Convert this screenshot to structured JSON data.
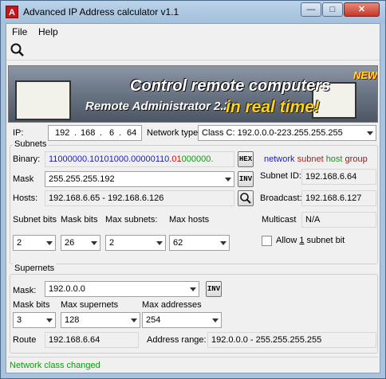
{
  "window": {
    "title": "Advanced IP Address calculator v1.1"
  },
  "window_controls": {
    "minimize": "—",
    "maximize": "□",
    "close": "✕"
  },
  "menu": {
    "file": "File",
    "help": "Help"
  },
  "banner": {
    "line1": "Control remote computers",
    "line2": "Remote Administrator 2.2",
    "line3": "in real time!",
    "badge": "NEW!"
  },
  "ip": {
    "label": "IP:",
    "octet1": "192",
    "octet2": "168",
    "octet3": "6",
    "octet4": "64",
    "network_type_label": "Network type:",
    "network_type_value": "Class C: 192.0.0.0-223.255.255.255"
  },
  "subnets": {
    "title": "Subnets",
    "binary_label": "Binary:",
    "binary": {
      "network": "11000000.10101000.00000110.",
      "subnet": "01",
      "host": "000000."
    },
    "hex_button": "HEX",
    "legend": {
      "network": "network",
      "subnet": "subnet",
      "host": "host",
      "group": "group"
    },
    "mask_label": "Mask",
    "mask_value": "255.255.255.192",
    "inv_button": "INV",
    "subnet_id_label": "Subnet ID:",
    "subnet_id_value": "192.168.6.64",
    "hosts_label": "Hosts:",
    "hosts_value": "192.168.6.65 - 192.168.6.126",
    "broadcast_label": "Broadcast:",
    "broadcast_value": "192.168.6.127",
    "col_subnet_bits": "Subnet bits",
    "col_mask_bits": "Mask bits",
    "col_max_subnets": "Max subnets:",
    "col_max_hosts": "Max hosts",
    "multicast_label": "Multicast",
    "multicast_value": "N/A",
    "subnet_bits_value": "2",
    "mask_bits_value": "26",
    "max_subnets_value": "2",
    "max_hosts_value": "62",
    "allow_label_pre": "Allow ",
    "allow_label_num": "1",
    "allow_label_post": " subnet bit"
  },
  "supernets": {
    "title": "Supernets",
    "mask_label": "Mask:",
    "mask_value": "192.0.0.0",
    "inv_button": "INV",
    "col_mask_bits": "Mask bits",
    "col_max_supernets": "Max supernets",
    "col_max_addresses": "Max addresses",
    "mask_bits_value": "3",
    "max_supernets_value": "128",
    "max_addresses_value": "254",
    "route_label": "Route",
    "route_value": "192.168.6.64",
    "address_range_label": "Address range:",
    "address_range_value": "192.0.0.0 - 255.255.255.255"
  },
  "status": {
    "text": "Network class changed"
  },
  "colors": {
    "network": "#1a1ad0",
    "subnet": "#cc1111",
    "host": "#119911",
    "group": "#aa1111",
    "status_text": "#119911"
  },
  "icons": {
    "app": "app-logo-icon",
    "search": "search-icon",
    "dropdown": "chevron-down-icon"
  }
}
